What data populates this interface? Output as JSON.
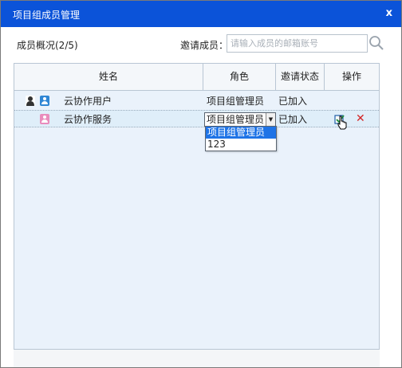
{
  "dialog": {
    "title": "项目组成员管理",
    "close_label": "x"
  },
  "toolbar": {
    "overview": "成员概况(2/5)",
    "invite_label": "邀请成员：",
    "invite_placeholder": "请输入成员的邮箱账号"
  },
  "table": {
    "headers": [
      "姓名",
      "角色",
      "邀请状态",
      "操作"
    ],
    "rows": [
      {
        "name": "云协作用户",
        "role": "项目组管理员",
        "status": "已加入"
      },
      {
        "name": "云协作服务",
        "role": "项目组管理员",
        "status": "已加入"
      }
    ]
  },
  "role_dropdown": {
    "selected": "项目组管理员",
    "options": [
      "项目组管理员",
      "123"
    ]
  },
  "colors": {
    "titlebar": "#0b53d9",
    "table_bg": "#eaf2fb",
    "highlight": "#1e73e6",
    "delete": "#d42424"
  }
}
